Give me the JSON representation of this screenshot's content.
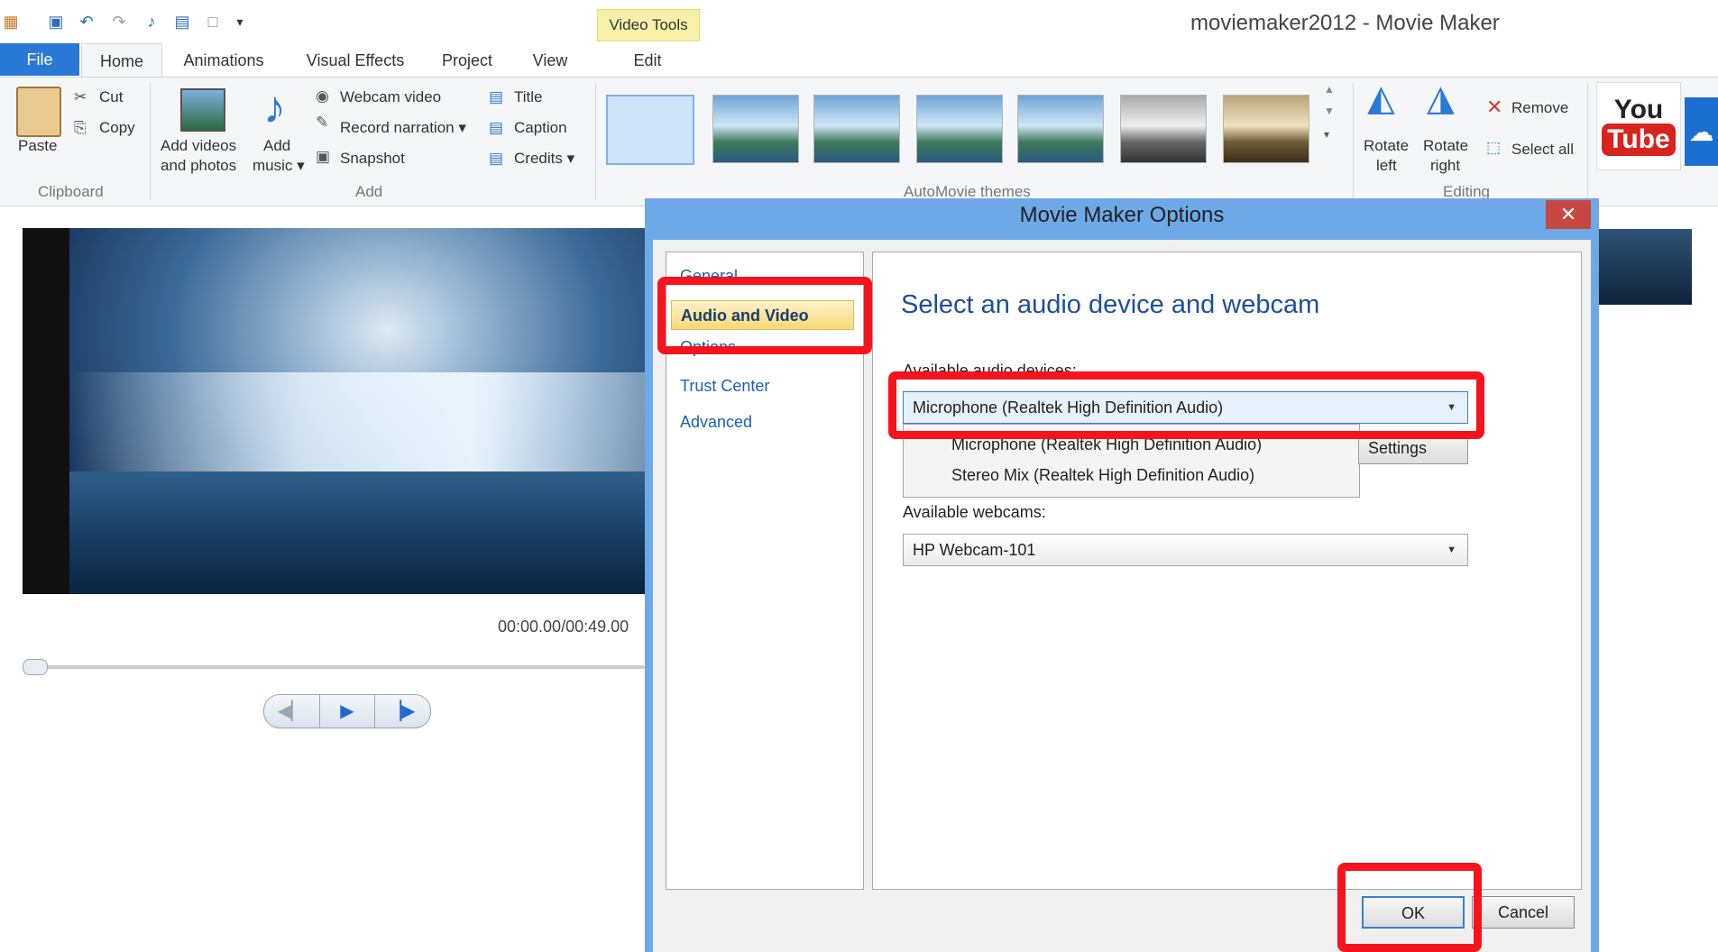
{
  "window": {
    "title": "moviemaker2012 - Movie Maker",
    "contextual_tab": "Video Tools"
  },
  "quick_access": [
    "save-icon",
    "undo-icon",
    "redo-icon",
    "music-icon",
    "film-icon",
    "new-icon",
    "customize-icon"
  ],
  "tabs": {
    "file": "File",
    "home": "Home",
    "animations": "Animations",
    "visual_effects": "Visual Effects",
    "project": "Project",
    "view": "View",
    "edit": "Edit"
  },
  "ribbon": {
    "clipboard": {
      "paste": "Paste",
      "cut": "Cut",
      "copy": "Copy",
      "group": "Clipboard"
    },
    "add": {
      "add_videos_1": "Add videos",
      "add_videos_2": "and photos",
      "add_music_1": "Add",
      "add_music_2": "music ▾",
      "webcam": "Webcam video",
      "narration": "Record narration ▾",
      "snapshot": "Snapshot",
      "title": "Title",
      "caption": "Caption",
      "credits": "Credits ▾",
      "group": "Add"
    },
    "themes": {
      "group": "AutoMovie themes"
    },
    "editing": {
      "rotate_left_1": "Rotate",
      "rotate_left_2": "left",
      "rotate_right_1": "Rotate",
      "rotate_right_2": "right",
      "remove": "Remove",
      "select_all": "Select all",
      "group": "Editing"
    },
    "share": {
      "youtube_1": "You",
      "youtube_2": "Tube"
    }
  },
  "preview": {
    "time": "00:00.00/00:49.00"
  },
  "dialog": {
    "title": "Movie Maker Options",
    "close": "✕",
    "nav": {
      "general": "General",
      "audio_video": "Audio and Video",
      "options": "Options",
      "trust_center": "Trust Center",
      "advanced": "Advanced"
    },
    "heading": "Select an audio device and webcam",
    "audio_label": "Available audio devices:",
    "audio_selected": "Microphone (Realtek High Definition Audio)",
    "audio_options": [
      "Microphone (Realtek High Definition Audio)",
      "Stereo Mix (Realtek High Definition Audio)"
    ],
    "settings": "Settings",
    "webcam_label": "Available webcams:",
    "webcam_selected": "HP Webcam-101",
    "ok": "OK",
    "cancel": "Cancel"
  },
  "colors": {
    "accent": "#2b79d6",
    "highlight": "#f5141d",
    "dialog_frame": "#6ea9e7",
    "link": "#1d5fb3"
  }
}
